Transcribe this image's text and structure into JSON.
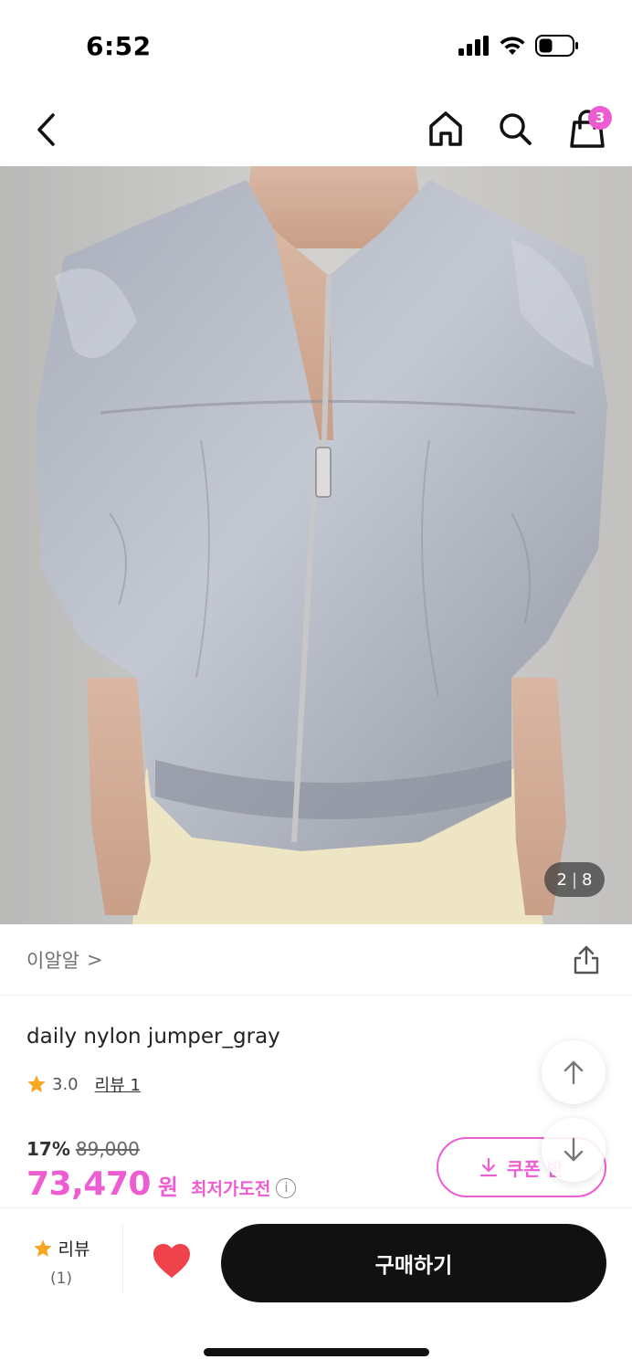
{
  "status_bar": {
    "time": "6:52"
  },
  "nav": {
    "cart_count": "3",
    "icons": [
      "chevron-left-icon",
      "home-icon",
      "search-icon",
      "shopping-bag-icon"
    ]
  },
  "image": {
    "current": "2",
    "separator": "|",
    "total": "8"
  },
  "brand": {
    "name": "이알알",
    "arrow": ">"
  },
  "product": {
    "title": "daily nylon jumper_gray",
    "rating": "3.0",
    "review_link": "리뷰 1"
  },
  "price": {
    "discount_rate": "17%",
    "original_price": "89,000",
    "sale_price": "73,470",
    "currency": "원",
    "lowest_tag": "최저가도전",
    "info_symbol": "i"
  },
  "coupon": {
    "label": "쿠폰 받"
  },
  "bottom_bar": {
    "review_label": "리뷰",
    "review_count": "(1)",
    "buy_label": "구매하기"
  },
  "colors": {
    "accent": "#ee5cd2",
    "star": "#f6a623",
    "heart": "#f0424a",
    "buy_button": "#111111"
  }
}
